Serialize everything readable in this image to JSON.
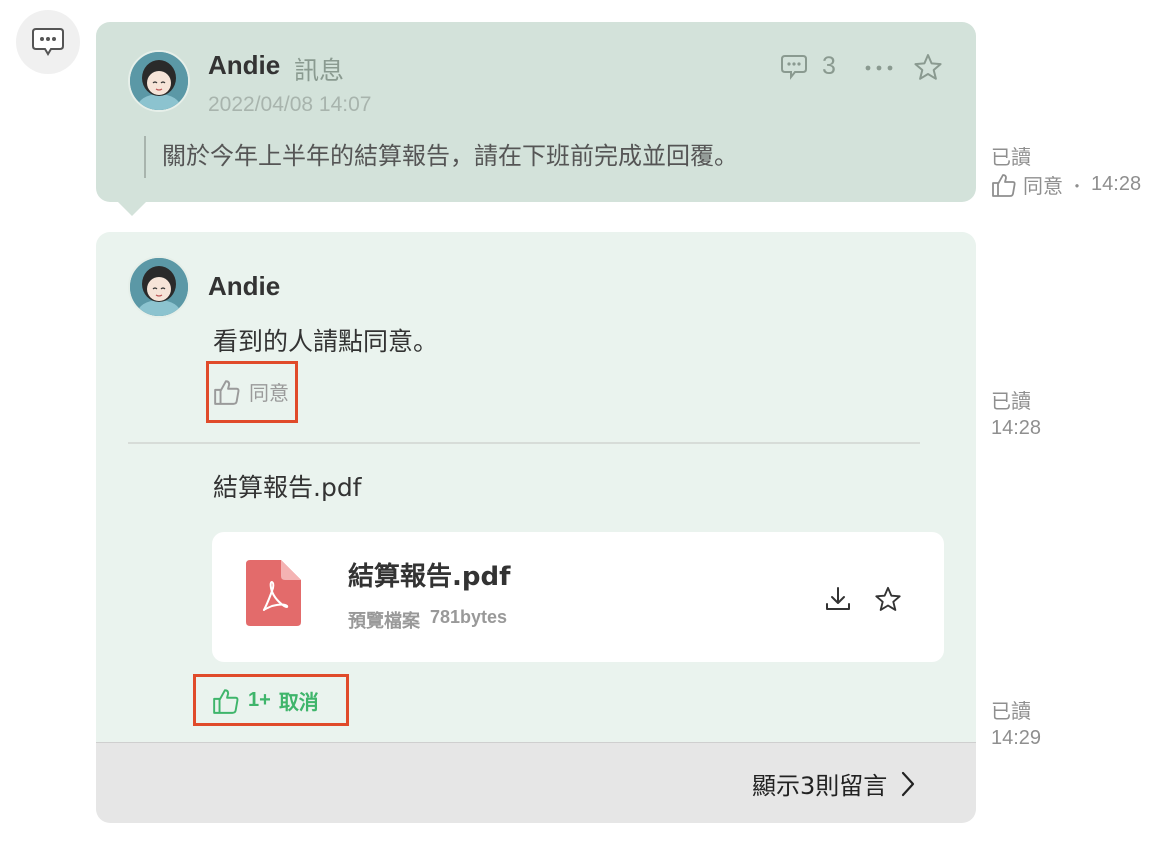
{
  "post": {
    "author": "Andie",
    "type_label": "訊息",
    "datetime": "2022/04/08 14:07",
    "comment_count": "3",
    "quote_text": "關於今年上半年的結算報告，請在下班前完成並回覆。"
  },
  "post_status": {
    "read_label": "已讀",
    "agree_label": "同意",
    "separator": "・",
    "time": "14:28"
  },
  "comment1": {
    "author": "Andie",
    "text": "看到的人請點同意。",
    "agree_label": "同意"
  },
  "comment1_status": {
    "read_label": "已讀",
    "time": "14:28"
  },
  "comment2": {
    "text": "結算報告.pdf",
    "file_name": "結算報告.pdf",
    "preview_label": "預覽檔案",
    "file_size": "781bytes",
    "agree_count": "1+",
    "cancel_label": "取消"
  },
  "comment2_status": {
    "read_label": "已讀",
    "time": "14:29"
  },
  "footer": {
    "show_comments_label": "顯示3則留言"
  },
  "colors": {
    "header_bg": "#d3e2da",
    "body_bg": "#eaf3ee",
    "agree_green": "#3fb56b",
    "highlight_red": "#e04a2a",
    "pdf_red": "#e05e5e"
  }
}
